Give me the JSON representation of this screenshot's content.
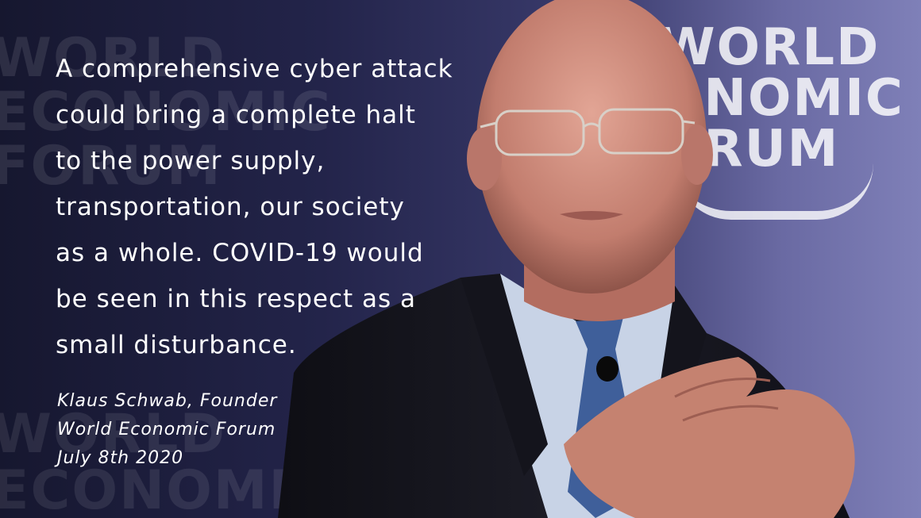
{
  "quote": {
    "text": "A comprehensive cyber attack\ncould bring a complete halt\nto the power supply,\ntransportation, our society\nas a whole. COVID-19 would\nbe seen in this respect as a\nsmall disturbance."
  },
  "attribution": {
    "name_line": "Klaus Schwab, Founder",
    "org_line": "World Economic Forum",
    "date_line": "July 8th 2020"
  },
  "background": {
    "logo_top_left": [
      "WORLD",
      "ECONOMIC",
      "FORUM"
    ],
    "logo_bottom_left": [
      "WORLD",
      "ECONOMIC"
    ],
    "logo_right": [
      "WORLD",
      "ONOMIC",
      "ORUM"
    ]
  },
  "colors": {
    "text": "#ffffff",
    "suit": "#15151c",
    "tie": "#3f5f9a",
    "skin": "#c9897a",
    "shirt": "#c8d3e6"
  }
}
